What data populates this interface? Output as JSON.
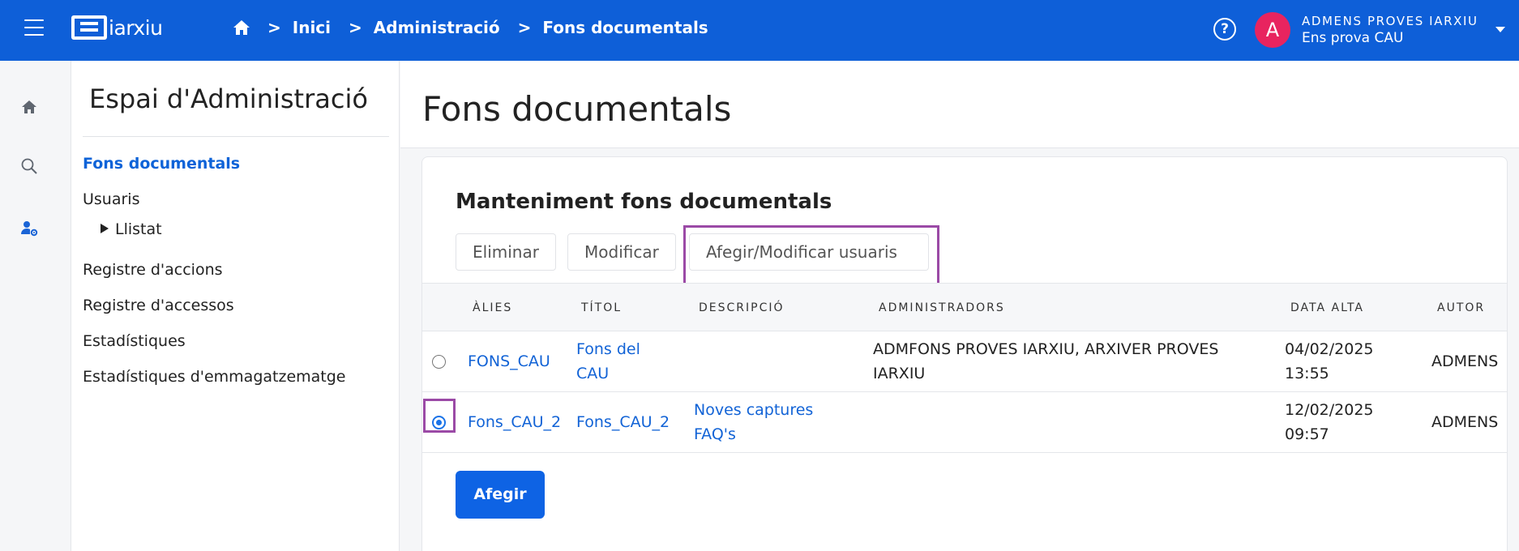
{
  "topbar": {
    "logo_text": "iarxiu",
    "breadcrumb": [
      "Inici",
      "Administració",
      "Fons documentals"
    ],
    "separator": ">",
    "help_label": "?",
    "user_initial": "A",
    "user_name": "ADMENS PROVES IARXIU",
    "user_org": "Ens prova CAU",
    "bar_color": "#0e5fd8"
  },
  "rail": {
    "icons": [
      "home-icon",
      "search-icon",
      "admin-user-icon"
    ]
  },
  "sidebar": {
    "title": "Espai d'Administració",
    "items": [
      {
        "label": "Fons documentals",
        "active": true
      },
      {
        "label": "Usuaris"
      },
      {
        "label": "Llistat",
        "sub": true
      },
      {
        "label": "Registre d'accions"
      },
      {
        "label": "Registre d'accessos"
      },
      {
        "label": "Estadístiques"
      },
      {
        "label": "Estadístiques d'emmagatzematge"
      }
    ]
  },
  "main": {
    "page_title": "Fons documentals",
    "card_title": "Manteniment fons documentals",
    "actions": {
      "delete": "Eliminar",
      "modify": "Modificar",
      "users": "Afegir/Modificar usuaris"
    },
    "table": {
      "headers": [
        "ÀLIES",
        "TÍTOL",
        "DESCRIPCIÓ",
        "ADMINISTRADORS",
        "DATA ALTA",
        "AUTOR"
      ],
      "rows": [
        {
          "selected": false,
          "alies": "FONS_CAU",
          "titol_1": "Fons del",
          "titol_2": "CAU",
          "descripcio_1": "",
          "descripcio_2": "",
          "administradors_1": "ADMFONS PROVES IARXIU, ARXIVER PROVES",
          "administradors_2": "IARXIU",
          "data_1": "04/02/2025",
          "data_2": "13:55",
          "autor": "ADMENS"
        },
        {
          "selected": true,
          "alies": "Fons_CAU_2",
          "titol_1": "Fons_CAU_2",
          "titol_2": "",
          "descripcio_1": "Noves captures",
          "descripcio_2": "FAQ's",
          "administradors_1": "",
          "administradors_2": "",
          "data_1": "12/02/2025",
          "data_2": "09:57",
          "autor": "ADMENS"
        }
      ]
    },
    "add_button": "Afegir",
    "accent_color": "#0e63e4",
    "highlight_color": "#9b4aa6"
  }
}
